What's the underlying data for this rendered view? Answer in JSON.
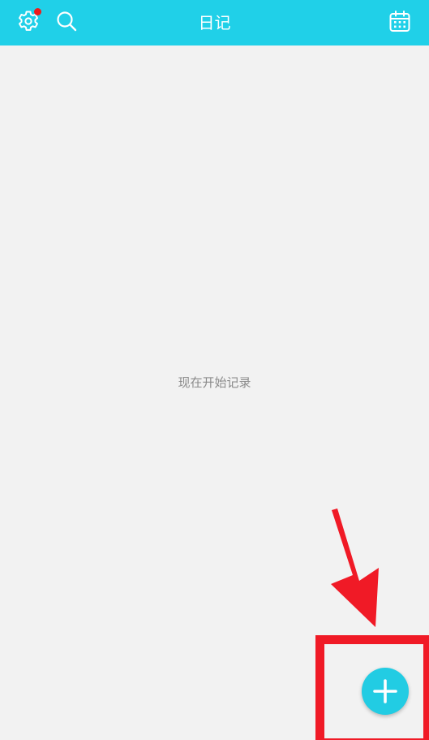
{
  "header": {
    "title": "日记",
    "has_notification": true,
    "icons": {
      "settings": "gear-icon",
      "search": "search-icon",
      "calendar": "calendar-icon"
    }
  },
  "main": {
    "empty_message": "现在开始记录"
  },
  "fab": {
    "icon": "plus-icon"
  },
  "colors": {
    "topbar": "#20d0e8",
    "background": "#f2f2f2",
    "fab": "#22cce3",
    "notification": "#f01919",
    "annotation": "#f01a26",
    "empty_text": "#8a8a8a"
  }
}
